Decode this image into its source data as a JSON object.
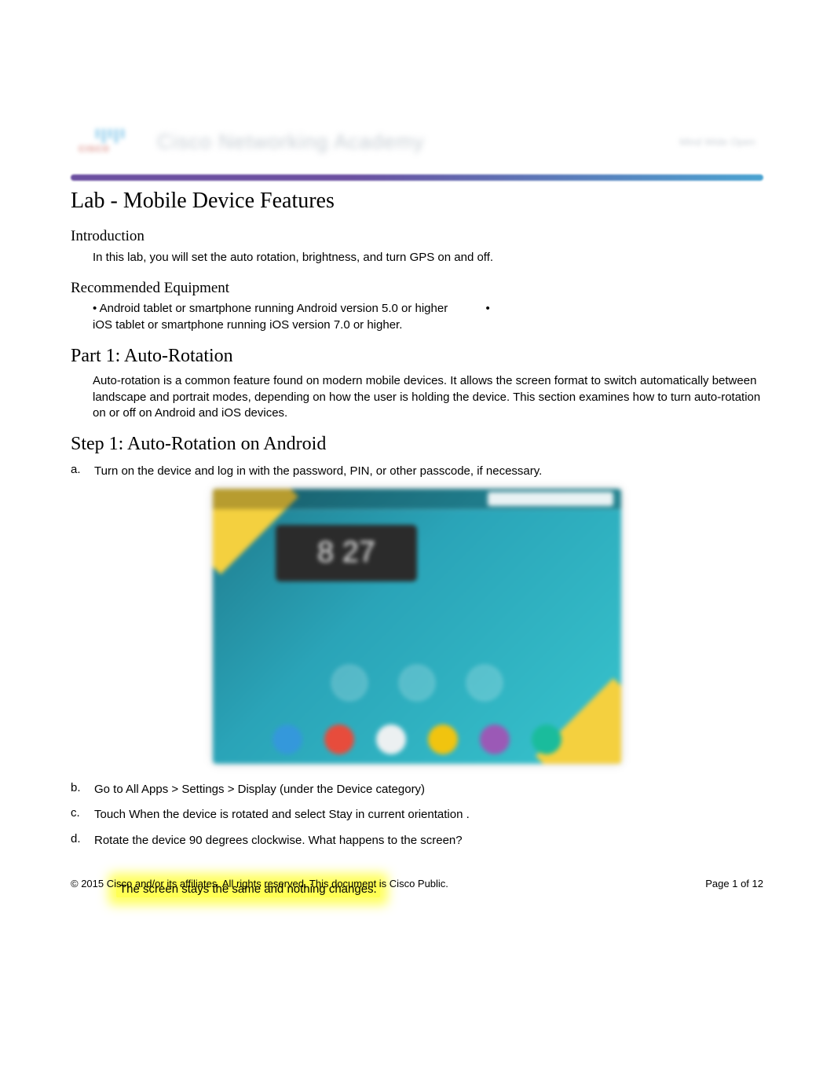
{
  "header": {
    "academy_title": "Cisco Networking Academy",
    "tagline": "Mind Wide Open"
  },
  "doc": {
    "title": "Lab - Mobile Device Features",
    "introduction_head": "Introduction",
    "introduction_body": "In this lab, you will set the auto rotation, brightness, and turn GPS on and off.",
    "equipment_head": "Recommended Equipment",
    "equipment_bullet1_prefix": "•   Android tablet or smartphone running Android version 5.0 or higher",
    "equipment_bullet1_suffix": "•",
    "equipment_bullet2": "iOS tablet or smartphone running iOS version 7.0 or higher.",
    "part1_head": "Part 1: Auto-Rotation",
    "part1_body": "Auto-rotation is a common feature found on modern mobile devices. It allows the screen format to switch automatically between    landscape    and  portrait   modes, depending on how the user is holding the device. This section examines how to turn       auto-rotation     on or off on Android and iOS devices.",
    "step1_head": "Step 1: Auto-Rotation on Android",
    "steps": {
      "a": {
        "marker": "a.",
        "text": "Turn on the device and log in with the password, PIN, or other passcode, if necessary."
      },
      "b": {
        "marker": "b.",
        "text": "Go to   All Apps > Settings > Display        (under the   Device   category)"
      },
      "c": {
        "marker": "c.",
        "text": "Touch   When the device is rotated         and select    Stay in current orientation       ."
      },
      "d": {
        "marker": "d.",
        "text": "Rotate the device 90 degrees clockwise. What happens to the screen?"
      }
    },
    "screenshot": {
      "clock": "8 27"
    },
    "answer": "The screen stays the same and nothing changes.",
    "footer_left": "© 2015 Cisco and/or its affiliates. All rights reserved. This document is Cisco Public.",
    "footer_right": "Page  1 of 12"
  }
}
